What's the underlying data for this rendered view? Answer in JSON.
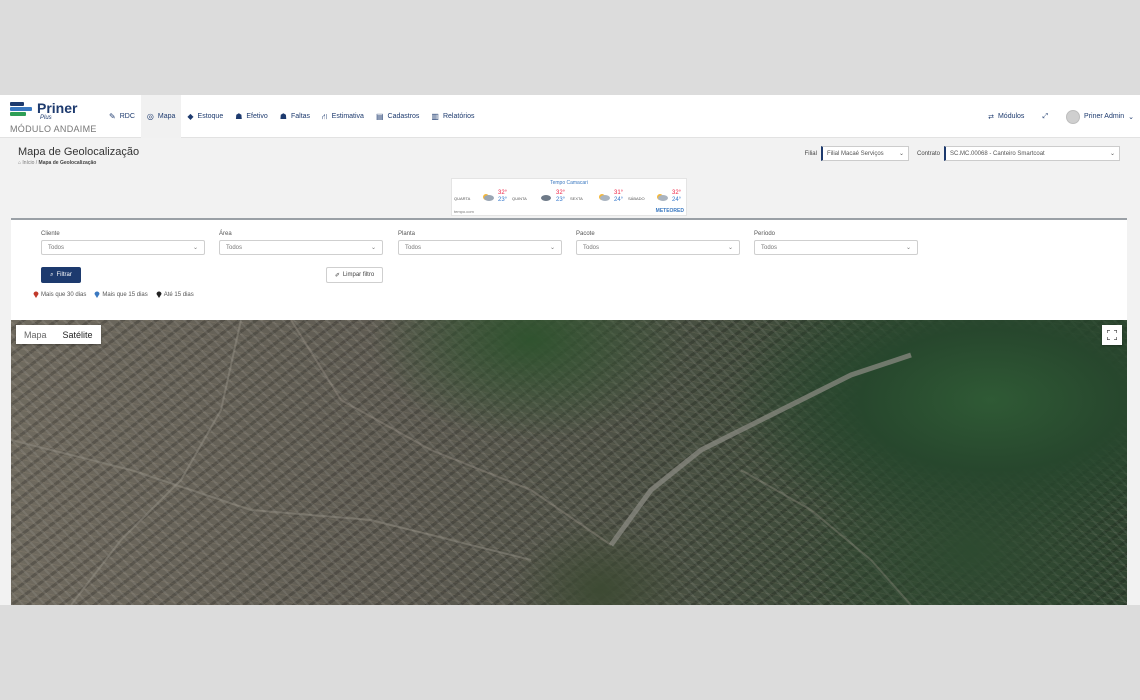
{
  "brand": {
    "name": "Priner",
    "sub": "Plus",
    "module": "MÓDULO ANDAIME"
  },
  "nav": [
    {
      "label": "RDC",
      "icon": "edit-icon",
      "glyph": "✎"
    },
    {
      "label": "Mapa",
      "icon": "map-pin-icon",
      "glyph": "◎"
    },
    {
      "label": "Estoque",
      "icon": "tag-icon",
      "glyph": "◆"
    },
    {
      "label": "Efetivo",
      "icon": "users-icon",
      "glyph": "☗"
    },
    {
      "label": "Faltas",
      "icon": "user-minus-icon",
      "glyph": "☗"
    },
    {
      "label": "Estimativa",
      "icon": "road-icon",
      "glyph": "⛙"
    },
    {
      "label": "Cadastros",
      "icon": "table-icon",
      "glyph": "▤"
    },
    {
      "label": "Relatórios",
      "icon": "bar-chart-icon",
      "glyph": "▥"
    }
  ],
  "active_nav": "Mapa",
  "top_right": {
    "modules_label": "Módulos",
    "user_label": "Priner Admin"
  },
  "page": {
    "title": "Mapa de Geolocalização",
    "breadcrumb_home": "Início",
    "breadcrumb_current": "Mapa de Geolocalização"
  },
  "header_filters": {
    "filial_label": "Filial",
    "filial_value": "Filial Macaé Serviços",
    "contrato_label": "Contrato",
    "contrato_value": "SC.MC.00068 - Canteiro Smartcoat"
  },
  "weather": {
    "title": "Tempo Camacari",
    "days": [
      {
        "day": "QUARTA",
        "high": "32°",
        "low": "23°"
      },
      {
        "day": "QUINTA",
        "high": "32°",
        "low": "23°"
      },
      {
        "day": "SEXTA",
        "high": "31°",
        "low": "24°"
      },
      {
        "day": "SÁBADO",
        "high": "32°",
        "low": "24°"
      }
    ],
    "source": "tempo.com",
    "brand": "METEORED"
  },
  "filters": [
    {
      "label": "Cliente",
      "value": "Todos"
    },
    {
      "label": "Área",
      "value": "Todos"
    },
    {
      "label": "Planta",
      "value": "Todos"
    },
    {
      "label": "Pacote",
      "value": "Todos"
    },
    {
      "label": "Período",
      "value": "Todos"
    }
  ],
  "buttons": {
    "filter": "Filtrar",
    "clear": "Limpar filtro"
  },
  "legend": [
    {
      "label": "Mais que 30 dias",
      "color": "#c0392b"
    },
    {
      "label": "Mais que 15 dias",
      "color": "#3a78c0"
    },
    {
      "label": "Até 15 dias",
      "color": "#222222"
    }
  ],
  "map": {
    "type_map": "Mapa",
    "type_satellite": "Satélite",
    "active": "Satélite"
  }
}
